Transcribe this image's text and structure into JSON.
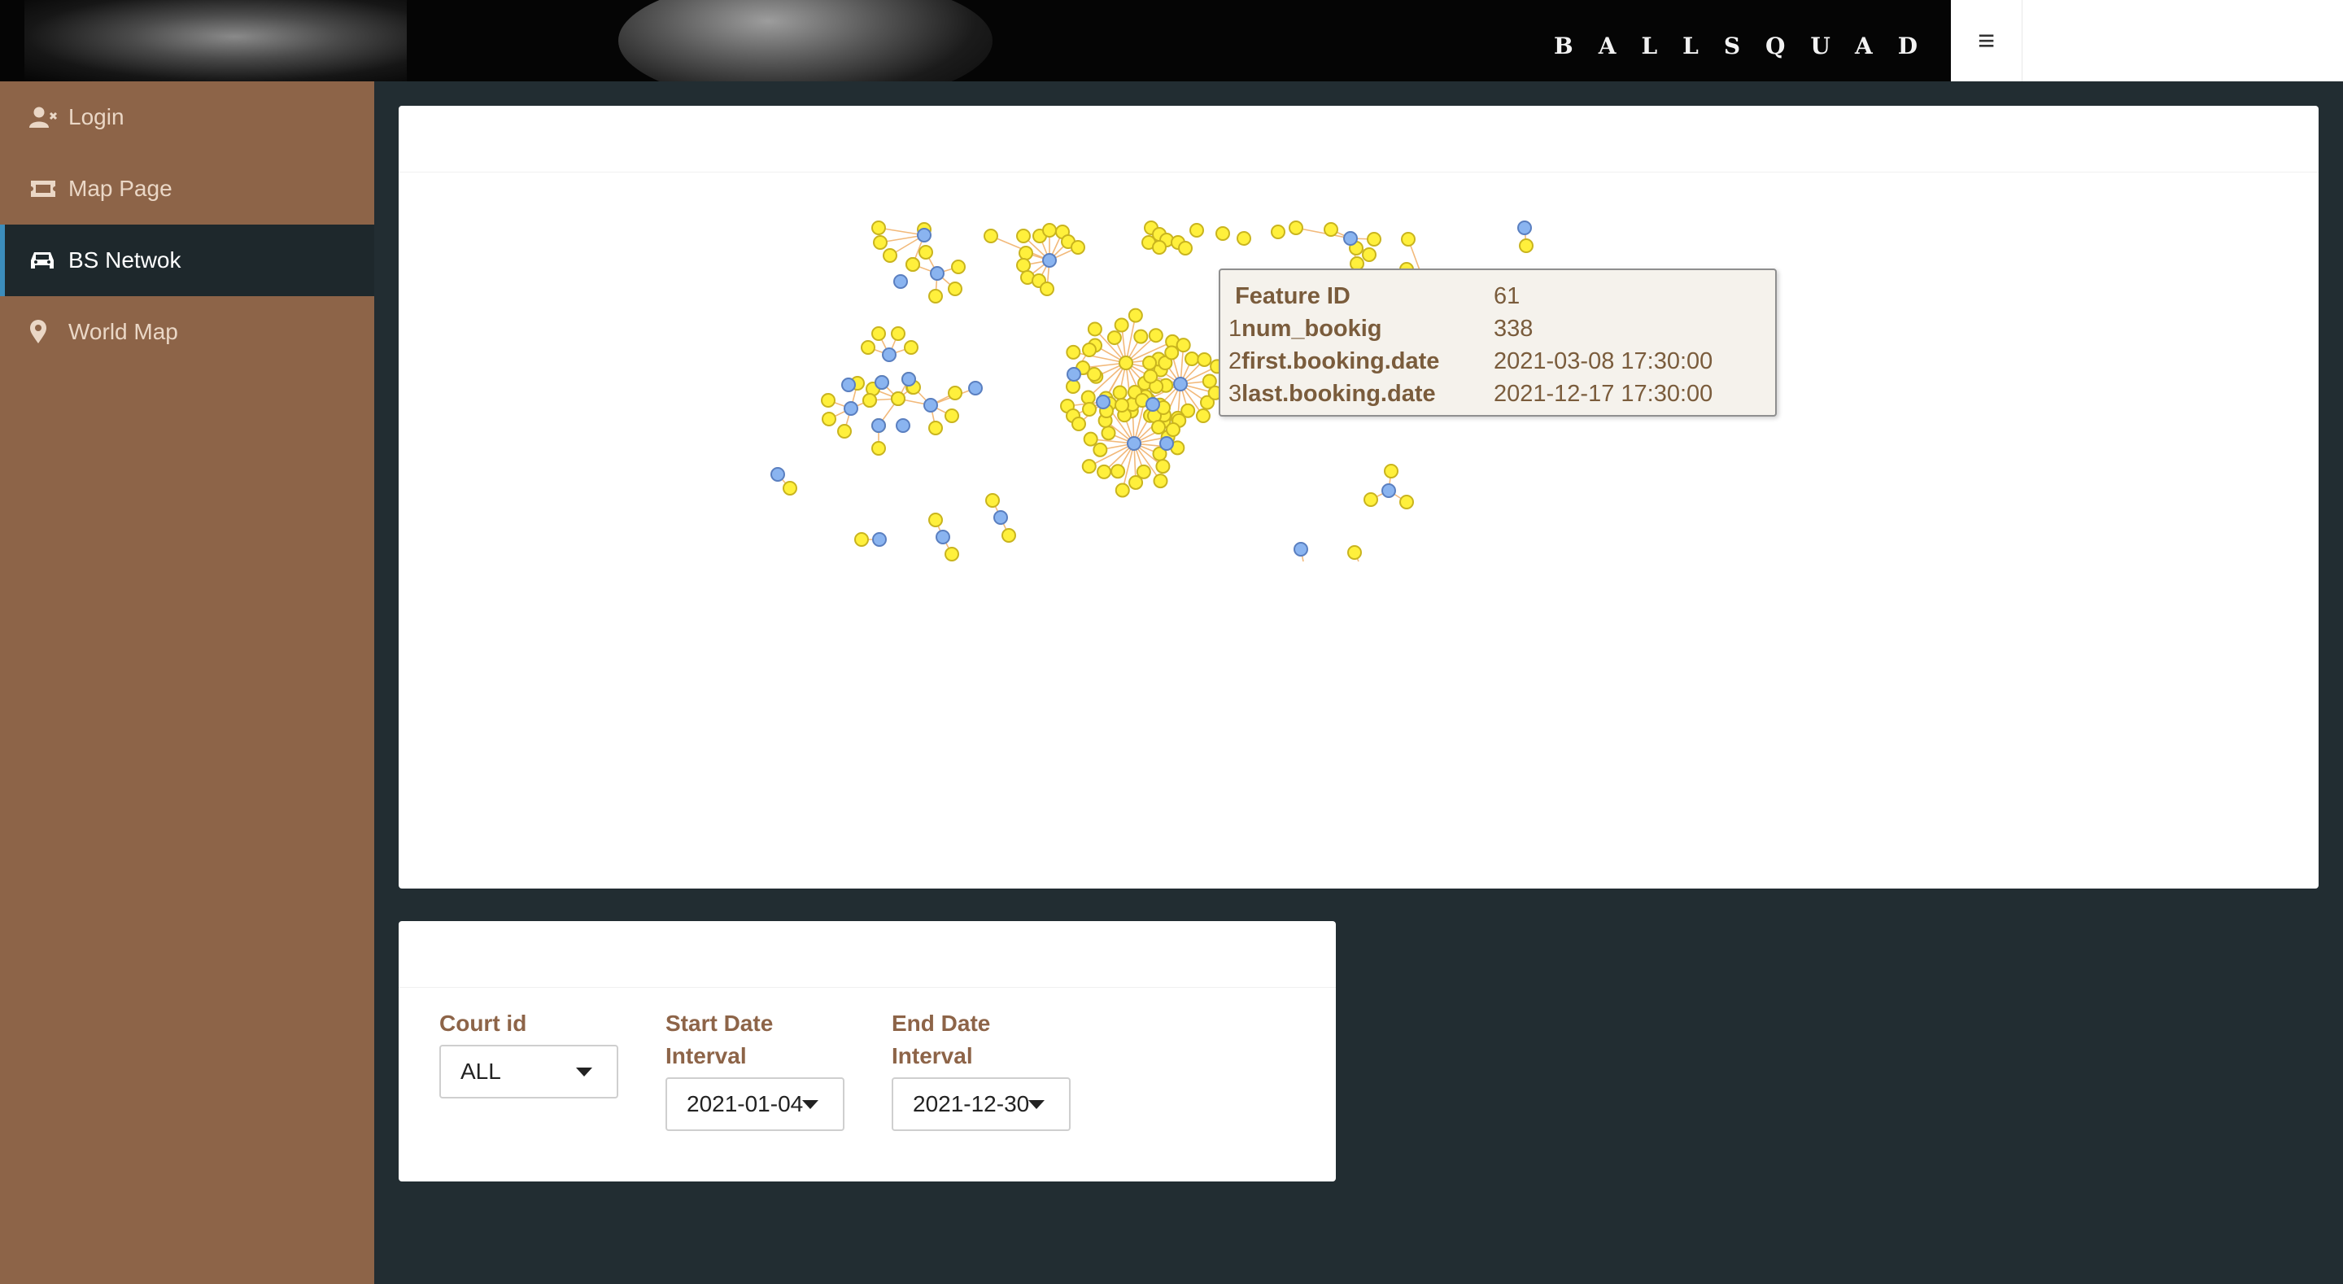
{
  "header": {
    "brand": "BALLSQUAD",
    "menu_icon": "hamburger-icon"
  },
  "sidebar": {
    "items": [
      {
        "label": "Login",
        "icon": "user-x-icon",
        "active": false
      },
      {
        "label": "Map Page",
        "icon": "ticket-icon",
        "active": false
      },
      {
        "label": "BS Netwok",
        "icon": "car-icon",
        "active": true
      },
      {
        "label": "World Map",
        "icon": "map-marker-icon",
        "active": false
      }
    ]
  },
  "network": {
    "colors": {
      "court": "#8ab4f0",
      "user": "#fff03c",
      "edge": "#f2b97a"
    },
    "tooltip": {
      "rows": [
        {
          "index": "",
          "key": "Feature ID",
          "value": "61"
        },
        {
          "index": "1",
          "key": "num_bookig",
          "value": "338"
        },
        {
          "index": "2",
          "key": "first.booking.date",
          "value": "2021-03-08 17:30:00"
        },
        {
          "index": "3",
          "key": "last.booking.date",
          "value": "2021-12-17 17:30:00"
        }
      ]
    }
  },
  "filters": {
    "court_id": {
      "label": "Court id",
      "value": "ALL"
    },
    "start_date": {
      "label": "Start Date Interval",
      "value": "2021-01-04"
    },
    "end_date": {
      "label": "End Date Interval",
      "value": "2021-12-30"
    }
  },
  "colors": {
    "sidebar": "#8d6448",
    "sidebar_active": "#1e282c",
    "body": "#222d32",
    "label": "#8d6448"
  }
}
